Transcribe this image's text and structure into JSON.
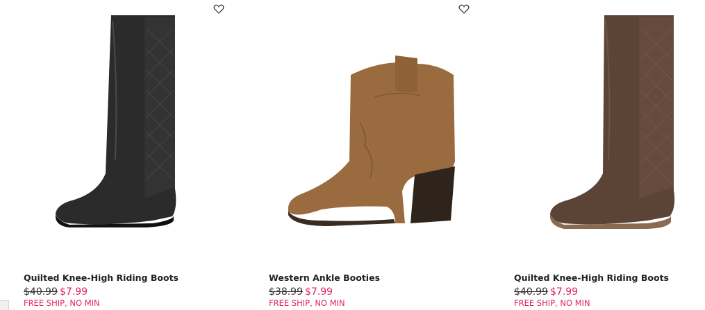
{
  "colors": {
    "sale_price": "#e0245e",
    "promo": "#e0245e",
    "text": "#222222"
  },
  "icons": {
    "wishlist": "heart-outline-icon"
  },
  "products": [
    {
      "title": "Quilted Knee-High Riding Boots",
      "original_price": "$40.99",
      "sale_price": "$7.99",
      "promo": "FREE SHIP, NO MIN",
      "image": "black-quilted-knee-high-boot"
    },
    {
      "title": "Western Ankle Booties",
      "original_price": "$38.99",
      "sale_price": "$7.99",
      "promo": "FREE SHIP, NO MIN",
      "image": "tan-western-ankle-bootie"
    },
    {
      "title": "Quilted Knee-High Riding Boots",
      "original_price": "$40.99",
      "sale_price": "$7.99",
      "promo": "FREE SHIP, NO MIN",
      "image": "brown-quilted-knee-high-boot"
    }
  ]
}
